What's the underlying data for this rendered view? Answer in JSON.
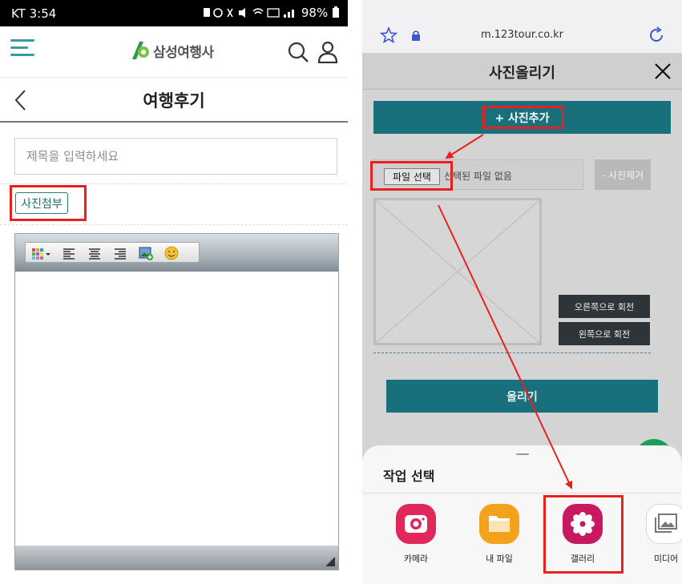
{
  "left_phone": {
    "status_bar": {
      "time": "KT 3:54",
      "battery": "98%"
    },
    "site": {
      "logo_text": "삼성여행사"
    },
    "page": {
      "title": "여행후기"
    },
    "form": {
      "title_placeholder": "제목을 입력하세요",
      "attach_button_label": "사진첨부"
    },
    "editor": {
      "toolbar_icons": [
        "color-grid-icon",
        "align-left-icon",
        "align-center-icon",
        "align-right-icon",
        "insert-image-icon",
        "emoticon-icon"
      ]
    }
  },
  "right_phone": {
    "browser": {
      "url": "m.123tour.co.kr"
    },
    "modal": {
      "title": "사진올리기",
      "add_photo_label": "+ 사진추가",
      "file_button_label": "파일 선택",
      "no_file_text": "선택된 파일 없음",
      "remove_photo_label": "- 사진제거",
      "rotate_right_label": "오른쪽으로 회전",
      "rotate_left_label": "왼쪽으로 회전",
      "upload_label": "올리기"
    },
    "action_sheet": {
      "title": "작업 선택",
      "apps": [
        {
          "label": "카메라",
          "icon": "camera-icon",
          "color": "#e0285a"
        },
        {
          "label": "내 파일",
          "icon": "folder-icon",
          "color": "#f3a21b"
        },
        {
          "label": "갤러리",
          "icon": "flower-icon",
          "color": "#c8185f"
        },
        {
          "label": "미디어",
          "icon": "image-stack-icon",
          "color": "#ffffff"
        }
      ]
    }
  },
  "colors": {
    "teal": "#19707d",
    "highlight_red": "#e8201f",
    "accent_teal": "#3a9ba3"
  }
}
